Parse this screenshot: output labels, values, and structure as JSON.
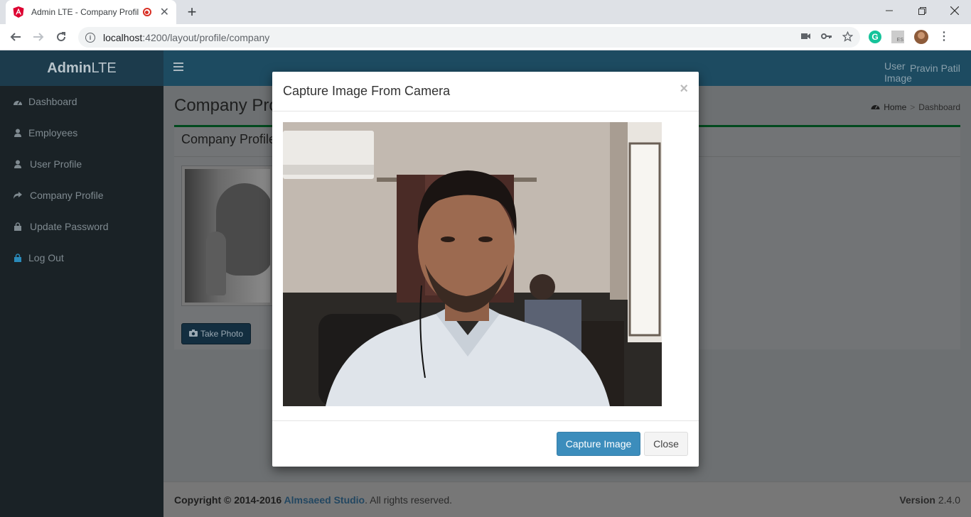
{
  "browser": {
    "tab_title": "Admin LTE - Company Profile",
    "new_tab": "+",
    "url_host": "localhost",
    "url_path": ":4200/layout/profile/company",
    "ext_g": "G",
    "ext_es": "ES"
  },
  "header": {
    "logo_bold": "Admin",
    "logo_light": "LTE",
    "user_image_alt": "User Image",
    "user_name": "Pravin Patil"
  },
  "sidebar": {
    "items": [
      {
        "label": "Dashboard",
        "icon": "dashboard-icon"
      },
      {
        "label": "Employees",
        "icon": "user-icon"
      },
      {
        "label": "User Profile",
        "icon": "user-icon"
      },
      {
        "label": "Company Profile",
        "icon": "share-icon"
      },
      {
        "label": "Update Password",
        "icon": "lock-icon"
      },
      {
        "label": "Log Out",
        "icon": "lock-icon",
        "color": "#2a8ab9"
      }
    ]
  },
  "content": {
    "page_title": "Company Profile",
    "breadcrumb_home": "Home",
    "breadcrumb_sep": ">",
    "breadcrumb_current": "Dashboard",
    "box_title": "Company Profile",
    "take_photo": "Take Photo"
  },
  "footer": {
    "copyright_prefix": "Copyright © 2014-2016 ",
    "company": "Almsaeed Studio",
    "rights": ". All rights reserved.",
    "version_label": "Version",
    "version_value": "2.4.0"
  },
  "modal": {
    "title": "Capture Image From Camera",
    "close_x": "×",
    "capture_button": "Capture Image",
    "close_button": "Close"
  },
  "colors": {
    "primary": "#3c8dbc",
    "header_bg": "#1d4b61",
    "sidebar_bg": "#1a2226",
    "box_border": "#00a65a"
  }
}
